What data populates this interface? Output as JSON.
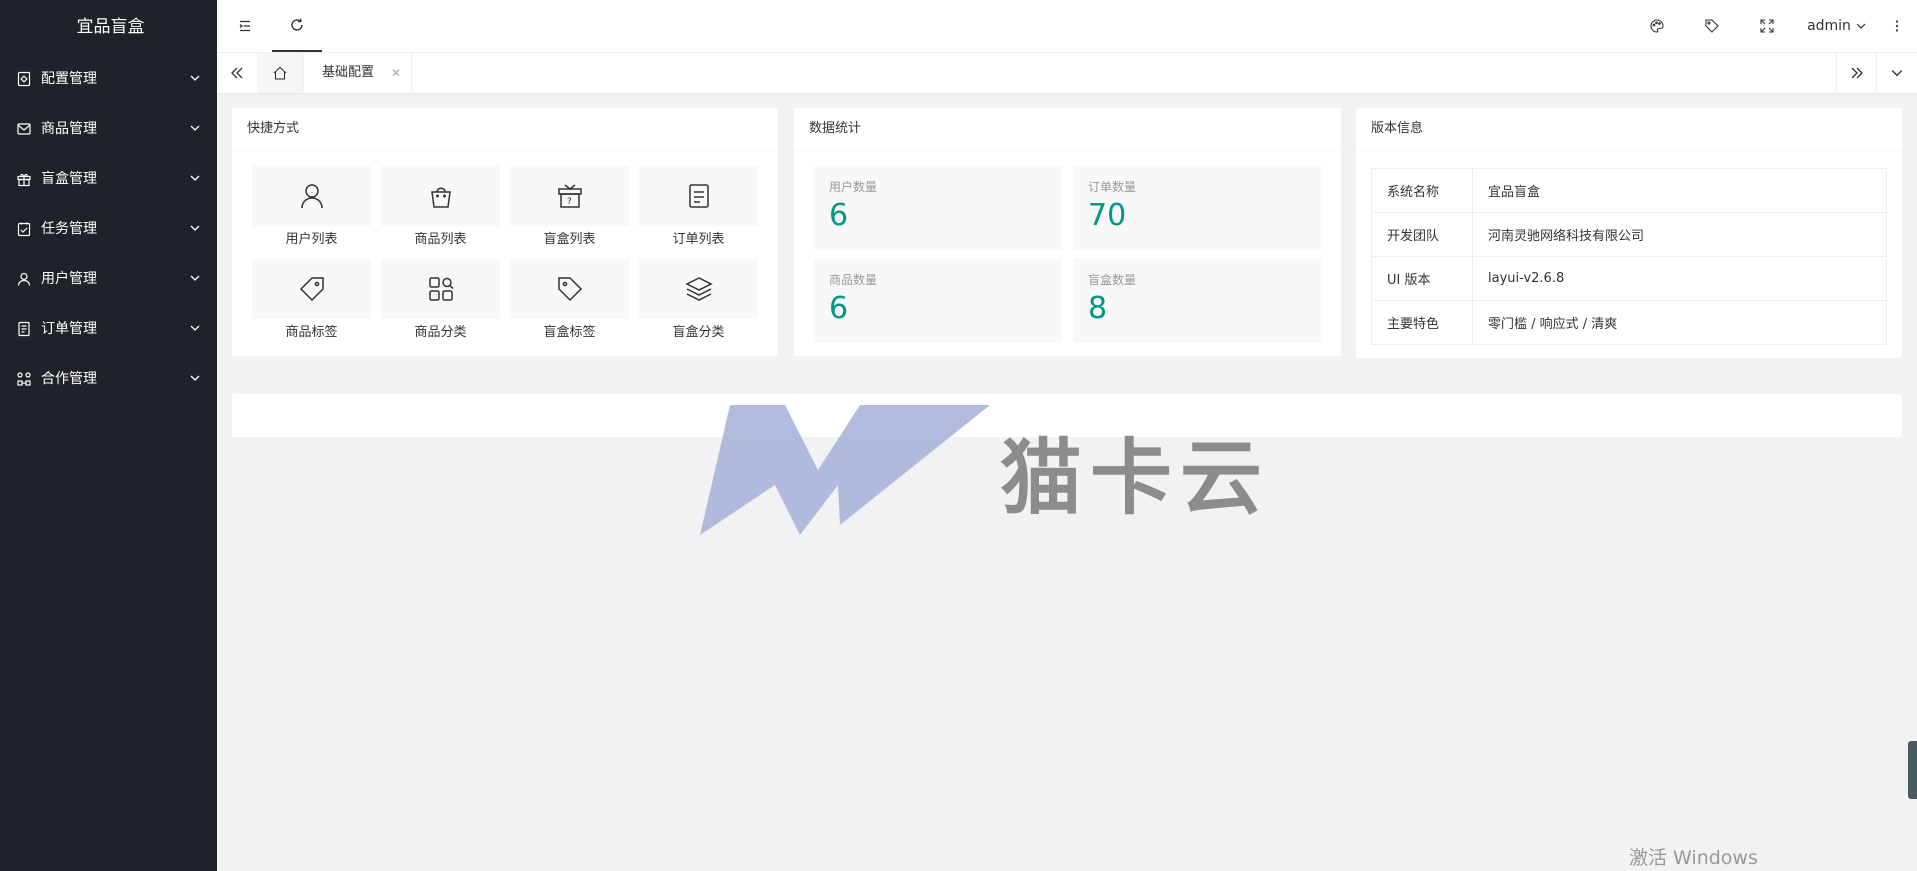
{
  "app": {
    "title": "宜品盲盒"
  },
  "sidebar": {
    "items": [
      {
        "label": "配置管理",
        "icon": "settings-doc-icon"
      },
      {
        "label": "商品管理",
        "icon": "mail-icon"
      },
      {
        "label": "盲盒管理",
        "icon": "gift-icon"
      },
      {
        "label": "任务管理",
        "icon": "task-check-icon"
      },
      {
        "label": "用户管理",
        "icon": "user-icon"
      },
      {
        "label": "订单管理",
        "icon": "order-doc-icon"
      },
      {
        "label": "合作管理",
        "icon": "cooperation-icon"
      }
    ]
  },
  "header": {
    "user": "admin"
  },
  "tabs": {
    "home_icon": "home-icon",
    "active": "基础配置"
  },
  "shortcuts": {
    "title": "快捷方式",
    "items": [
      {
        "label": "用户列表",
        "icon": "user-icon"
      },
      {
        "label": "商品列表",
        "icon": "bag-icon"
      },
      {
        "label": "盲盒列表",
        "icon": "mystery-box-icon"
      },
      {
        "label": "订单列表",
        "icon": "order-list-icon"
      },
      {
        "label": "商品标签",
        "icon": "tag-icon"
      },
      {
        "label": "商品分类",
        "icon": "category-icon"
      },
      {
        "label": "盲盒标签",
        "icon": "tags-icon"
      },
      {
        "label": "盲盒分类",
        "icon": "layers-icon"
      }
    ]
  },
  "stats": {
    "title": "数据统计",
    "items": [
      {
        "label": "用户数量",
        "value": "6"
      },
      {
        "label": "订单数量",
        "value": "70"
      },
      {
        "label": "商品数量",
        "value": "6"
      },
      {
        "label": "盲盒数量",
        "value": "8"
      }
    ]
  },
  "version": {
    "title": "版本信息",
    "rows": [
      {
        "key": "系统名称",
        "value": "宜品盲盒"
      },
      {
        "key": "开发团队",
        "value": "河南灵驰网络科技有限公司"
      },
      {
        "key": "UI 版本",
        "value": "layui-v2.6.8"
      },
      {
        "key": "主要特色",
        "value": "零门槛 / 响应式 / 清爽"
      }
    ]
  },
  "watermark": {
    "logo": "MK",
    "text": "猫卡云"
  },
  "system": {
    "activate": "激活 Windows"
  },
  "colors": {
    "sidebar": "#20222a",
    "accent": "#009688",
    "background": "#f2f2f2"
  }
}
